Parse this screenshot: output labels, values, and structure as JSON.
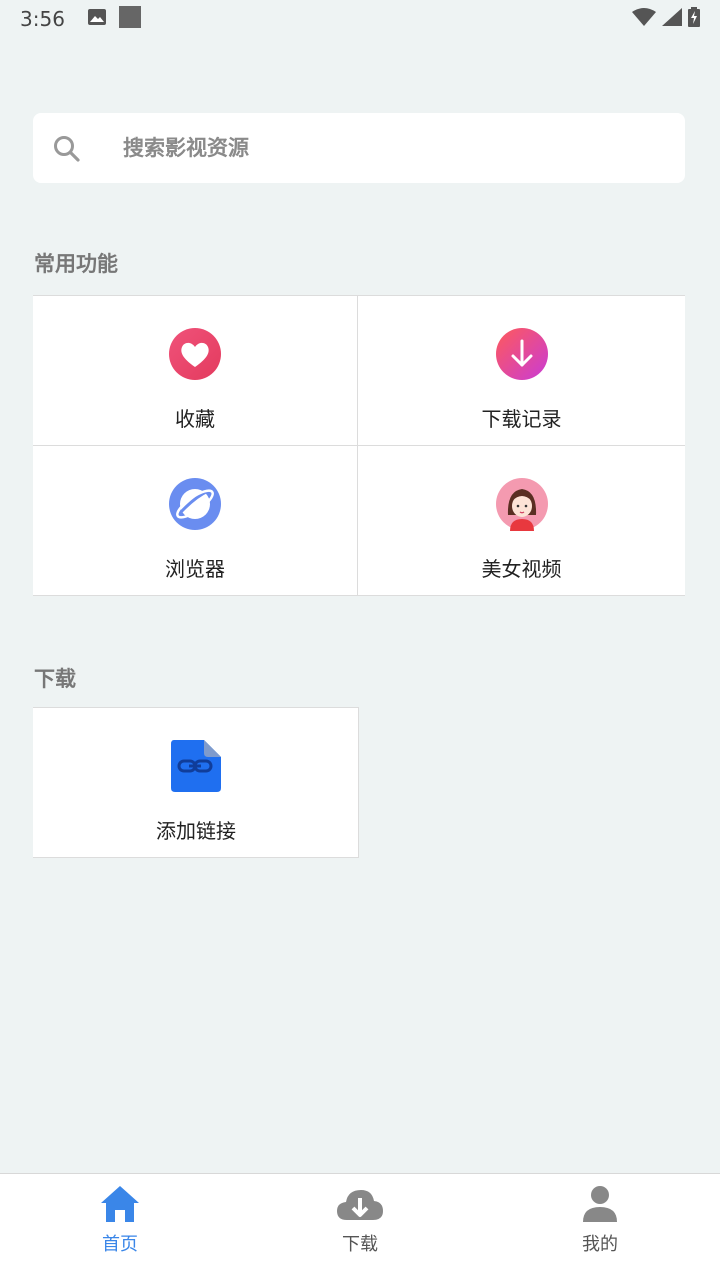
{
  "status": {
    "time": "3:56"
  },
  "search": {
    "placeholder": "搜索影视资源"
  },
  "sections": {
    "common": {
      "title": "常用功能",
      "items": [
        {
          "label": "收藏",
          "icon": "heart-icon"
        },
        {
          "label": "下载记录",
          "icon": "download-circle-icon"
        },
        {
          "label": "浏览器",
          "icon": "planet-icon"
        },
        {
          "label": "美女视频",
          "icon": "girl-avatar-icon"
        }
      ]
    },
    "download": {
      "title": "下载",
      "items": [
        {
          "label": "添加链接",
          "icon": "link-file-icon"
        }
      ]
    }
  },
  "tabbar": {
    "active_color": "#3a86e8",
    "items": [
      {
        "label": "首页",
        "icon": "home-icon",
        "active": true
      },
      {
        "label": "下载",
        "icon": "cloud-download-icon",
        "active": false
      },
      {
        "label": "我的",
        "icon": "user-icon",
        "active": false
      }
    ]
  }
}
